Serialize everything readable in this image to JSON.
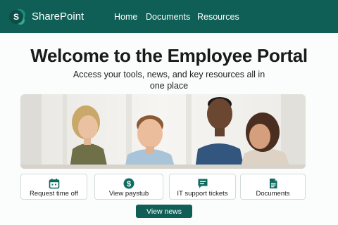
{
  "header": {
    "logo_letter": "S",
    "brand": "SharePoint",
    "nav": [
      "Home",
      "Documents",
      "Resources"
    ]
  },
  "main": {
    "title": "Welcome to the Employee Portal",
    "subtitle": "Access your tools, news, and key resources all in one place",
    "hero_image": "team-photo-image"
  },
  "quick_actions": [
    {
      "label": "Request time off",
      "icon": "calendar-icon"
    },
    {
      "label": "View paystub",
      "icon": "dollar-icon"
    },
    {
      "label": "IT support tickets",
      "icon": "chat-icon"
    },
    {
      "label": "Documents",
      "icon": "document-icon"
    }
  ],
  "cta": {
    "label": "View news"
  },
  "colors": {
    "brand": "#0f5f56",
    "accent": "#0f6b5f",
    "background": "#fbfcfc"
  }
}
